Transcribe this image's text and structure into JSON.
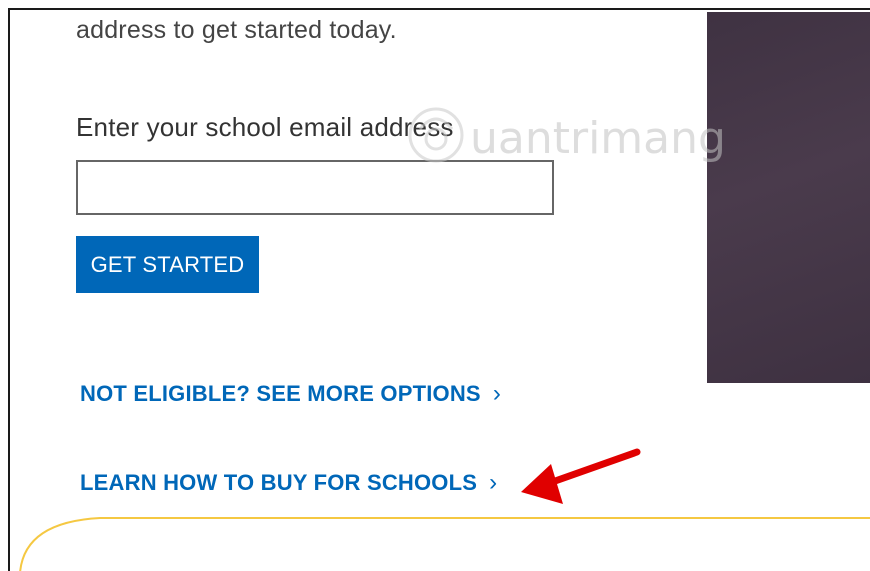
{
  "intro_text": "address to get started today.",
  "email_label": "Enter your school email address",
  "email_input": {
    "value": "",
    "placeholder": ""
  },
  "get_started_label": "GET STARTED",
  "links": {
    "not_eligible": "NOT ELIGIBLE? SEE MORE OPTIONS",
    "learn_schools": "LEARN HOW TO BUY FOR SCHOOLS",
    "chevron": "›"
  },
  "watermark_text": "uantrimang",
  "colors": {
    "accent": "#0067b8",
    "annotation_arrow": "#e00000",
    "yellow_border": "#f5c842",
    "image_panel": "#43364a"
  },
  "icons": {
    "link_chevron": "chevron-right-icon",
    "annotation": "red-arrow-icon",
    "watermark": "watermark-logo-icon"
  }
}
